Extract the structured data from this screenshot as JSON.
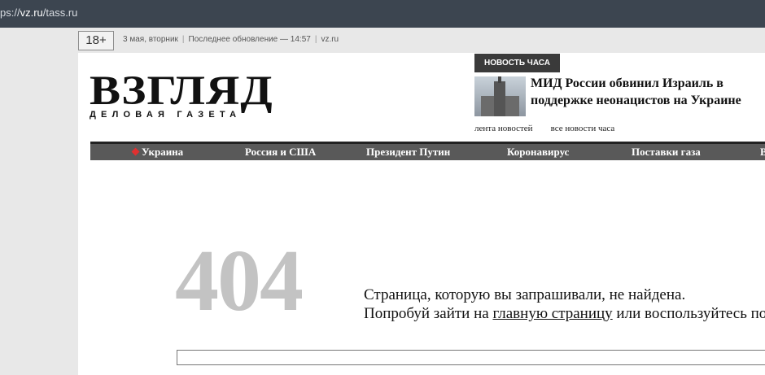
{
  "browser": {
    "url_prefix": "ps://",
    "url_host": "vz.ru",
    "url_path": "/tass.ru"
  },
  "topbar": {
    "age_rating": "18+",
    "date": "3 мая, вторник",
    "last_update": "Последнее обновление — 14:57",
    "site": "vz.ru"
  },
  "logo": {
    "title": "ВЗГЛЯД",
    "subtitle": "ДЕЛОВАЯ ГАЗЕТА"
  },
  "news": {
    "badge": "НОВОСТЬ ЧАСА",
    "headline": "МИД России обвинил Израиль в поддержке неонацистов на Украине",
    "thumbnail_icon": "building-thumbnail",
    "link_feed": "лента новостей",
    "link_all": "все новости часа"
  },
  "nav": {
    "marker_color": "#e03030",
    "items": [
      "Украина",
      "Россия и США",
      "Президент Путин",
      "Коронавирус",
      "Поставки газа",
      "Вн"
    ]
  },
  "error": {
    "code": "404",
    "line1": "Страница, которую вы запрашивали, не найдена.",
    "line2_before": "Попробуй зайти на ",
    "line2_link": "главную страницу",
    "line2_after": " или воспользуйтесь поиском",
    "search_value": ""
  }
}
